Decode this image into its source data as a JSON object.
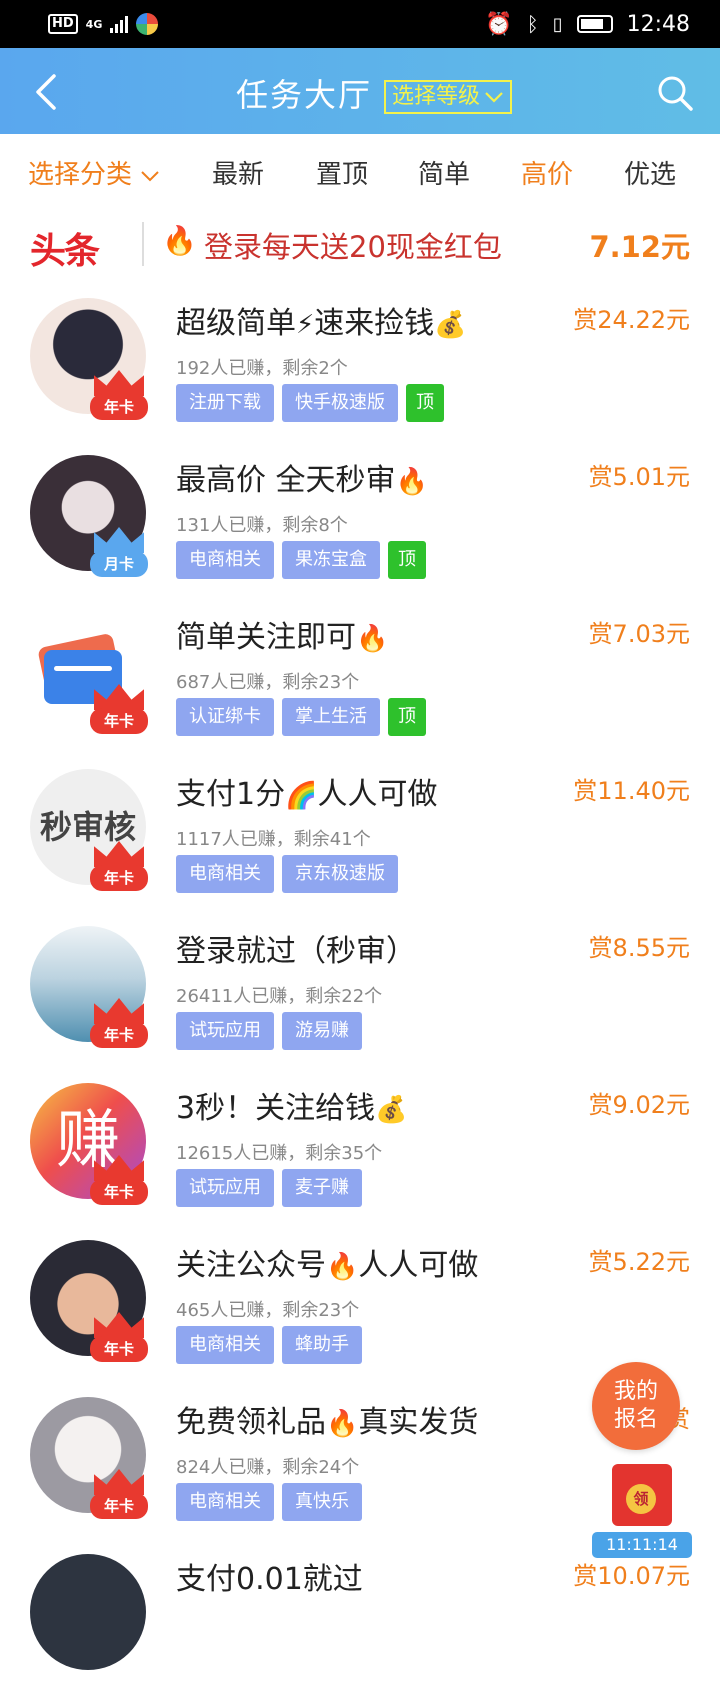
{
  "status_bar": {
    "hd": "HD",
    "network": "4G",
    "time": "12:48"
  },
  "header": {
    "title": "任务大厅",
    "level_select": "选择等级"
  },
  "tabs": [
    {
      "label": "选择分类"
    },
    {
      "label": "最新"
    },
    {
      "label": "置顶"
    },
    {
      "label": "简单"
    },
    {
      "label": "高价"
    },
    {
      "label": "优选"
    }
  ],
  "news": {
    "logo": "头条",
    "text": "登录每天送20现金红包",
    "amount": "7.12元"
  },
  "tasks": [
    {
      "title": "超级简单",
      "title_emoji": "⚡",
      "title_suffix": "速来捡钱",
      "title_emoji2": "💰",
      "meta": "192人已赚，剩余2个",
      "tags": [
        "注册下载",
        "快手极速版"
      ],
      "top": "顶",
      "reward": "赏24.22元",
      "badge": "年卡"
    },
    {
      "title": "最高价 全天秒审",
      "title_emoji": "🔥",
      "title_suffix": "",
      "title_emoji2": "",
      "meta": "131人已赚，剩余8个",
      "tags": [
        "电商相关",
        "果冻宝盒"
      ],
      "top": "顶",
      "reward": "赏5.01元",
      "badge": "月卡"
    },
    {
      "title": "简单关注即可",
      "title_emoji": "🔥",
      "title_suffix": "",
      "title_emoji2": "",
      "meta": "687人已赚，剩余23个",
      "tags": [
        "认证绑卡",
        "掌上生活"
      ],
      "top": "顶",
      "reward": "赏7.03元",
      "badge": "年卡"
    },
    {
      "title": "支付1分",
      "title_emoji": "🌈",
      "title_suffix": "人人可做",
      "title_emoji2": "",
      "meta": "1117人已赚，剩余41个",
      "tags": [
        "电商相关",
        "京东极速版"
      ],
      "top": "",
      "reward": "赏11.40元",
      "badge": "年卡",
      "avatar_text": "秒审核"
    },
    {
      "title": "登录就过（秒审）",
      "title_emoji": "",
      "title_suffix": "",
      "title_emoji2": "",
      "meta": "26411人已赚，剩余22个",
      "tags": [
        "试玩应用",
        "游易赚"
      ],
      "top": "",
      "reward": "赏8.55元",
      "badge": "年卡"
    },
    {
      "title": "3秒！关注给钱",
      "title_emoji": "💰",
      "title_suffix": "",
      "title_emoji2": "",
      "meta": "12615人已赚，剩余35个",
      "tags": [
        "试玩应用",
        "麦子赚"
      ],
      "top": "",
      "reward": "赏9.02元",
      "badge": "年卡",
      "avatar_text": "赚"
    },
    {
      "title": "关注公众号",
      "title_emoji": "🔥",
      "title_suffix": "人人可做",
      "title_emoji2": "",
      "meta": "465人已赚，剩余23个",
      "tags": [
        "电商相关",
        "蜂助手"
      ],
      "top": "",
      "reward": "赏5.22元",
      "badge": "年卡"
    },
    {
      "title": "免费领礼品",
      "title_emoji": "🔥",
      "title_suffix": "真实发货",
      "title_emoji2": "",
      "meta": "824人已赚，剩余24个",
      "tags": [
        "电商相关",
        "真快乐"
      ],
      "top": "",
      "reward": "赏",
      "badge": "年卡"
    },
    {
      "title": "支付0.01就过",
      "title_emoji": "",
      "title_suffix": "",
      "title_emoji2": "",
      "meta": "",
      "tags": [],
      "top": "",
      "reward": "赏10.07元",
      "badge": ""
    }
  ],
  "float": {
    "signup": "我的报名",
    "redpacket_coin": "领",
    "redpacket_timer": "11:11:14"
  },
  "colors": {
    "header_start": "#5aa7ee",
    "header_end": "#60bde6",
    "accent_orange": "#f07f1c",
    "tag_blue": "#8fa6f0",
    "tag_green": "#2ec12c",
    "badge_red": "#e8392f"
  },
  "icons": {
    "back": "chevron-left-icon",
    "search": "search-icon",
    "dropdown": "chevron-down-icon"
  }
}
